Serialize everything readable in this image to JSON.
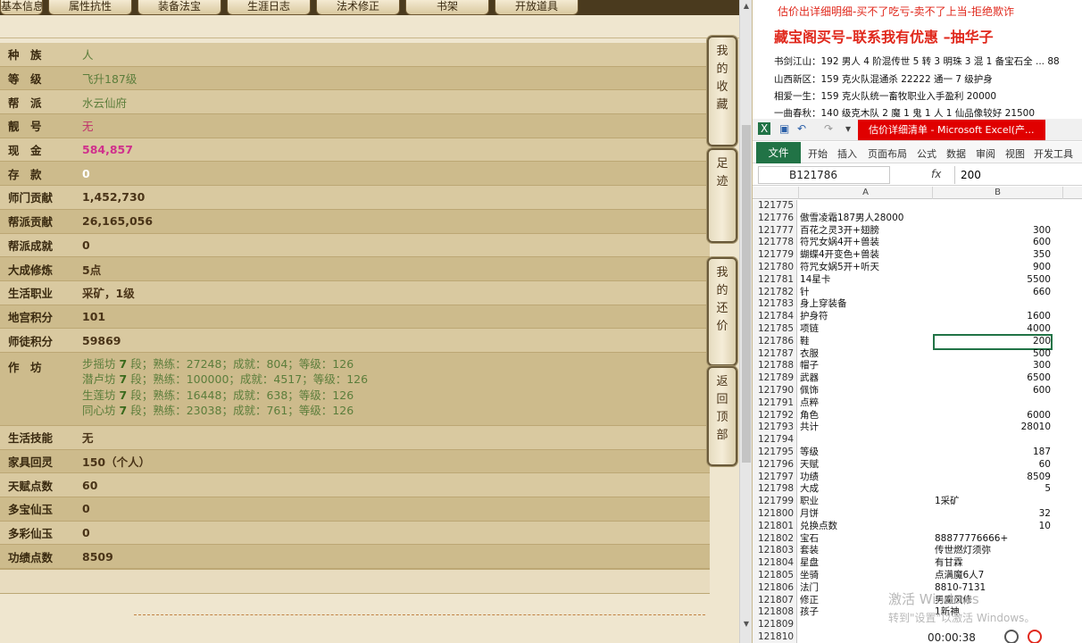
{
  "game": {
    "tabs": [
      "基本信息",
      "属性抗性",
      "装备法宝",
      "生涯日志",
      "法术修正",
      "书架",
      "开放道具"
    ],
    "rows": [
      {
        "label": "种　族",
        "value": "人",
        "style": "green"
      },
      {
        "label": "等　级",
        "value": "飞升187级",
        "style": "green"
      },
      {
        "label": "帮　派",
        "value": "水云仙府",
        "style": "green"
      },
      {
        "label": "靓　号",
        "value": "无",
        "style": "pink-plain"
      },
      {
        "label": "现　金",
        "value": "584,857",
        "style": "pink"
      },
      {
        "label": "存　款",
        "value": "0",
        "style": "white"
      },
      {
        "label": "师门贡献",
        "value": "1,452,730",
        "style": "dark"
      },
      {
        "label": "帮派贡献",
        "value": "26,165,056",
        "style": "dark"
      },
      {
        "label": "帮派成就",
        "value": "0",
        "style": "dark"
      },
      {
        "label": "大成修炼",
        "value": "5点",
        "style": "dark"
      },
      {
        "label": "生活职业",
        "value": "采矿，1级",
        "style": "dark"
      },
      {
        "label": "地宫积分",
        "value": "101",
        "style": "dark"
      },
      {
        "label": "师徒积分",
        "value": "59869",
        "style": "dark"
      }
    ],
    "workshop_label": "作　坊",
    "workshop": [
      {
        "name": "步摇坊",
        "level": "7",
        "rest": "段；熟练：27248；成就：804；等级：126"
      },
      {
        "name": "潜卢坊",
        "level": "7",
        "rest": "段；熟练：100000；成就：4517；等级：126"
      },
      {
        "name": "生莲坊",
        "level": "7",
        "rest": "段；熟练：16448；成就：638；等级：126"
      },
      {
        "name": "同心坊",
        "level": "7",
        "rest": "段；熟练：23038；成就：761；等级：126"
      }
    ],
    "rows2": [
      {
        "label": "生活技能",
        "value": "无",
        "style": "dark"
      },
      {
        "label": "家具回灵",
        "value": "150（个人）",
        "style": "dark"
      },
      {
        "label": "天赋点数",
        "value": "60",
        "style": "dark"
      },
      {
        "label": "多宝仙玉",
        "value": "0",
        "style": "dark"
      },
      {
        "label": "多彩仙玉",
        "value": "0",
        "style": "dark"
      },
      {
        "label": "功绩点数",
        "value": "8509",
        "style": "dark"
      }
    ],
    "side_buttons": [
      {
        "label": [
          "我",
          "的",
          "收",
          "藏"
        ]
      },
      {
        "label": [
          "足",
          "迹"
        ]
      },
      {
        "label": [
          "我",
          "的",
          "还",
          "价"
        ]
      },
      {
        "label": [
          "返",
          "回",
          "顶",
          "部"
        ]
      }
    ]
  },
  "notepad": {
    "line1": "估价出详细明细-买不了吃亏-卖不了上当-拒绝欺诈",
    "line2": "藏宝阁买号–联系我有优惠 –抽华子",
    "items": [
      "书剑江山：192 男人 4 阶混传世 5 转 3 明珠 3 混 1 备宝石全 ... 88",
      "山西新区：159 克火队混通杀 22222 通一 7 级护身",
      "相爱一生：159 克火队统一畜牧职业入手盈利 20000",
      "一曲春秋：140 级克木队 2 魔 1 鬼 1 人 1 仙品像较好 21500"
    ]
  },
  "excel": {
    "doc_title": "估价详细清单 - Microsoft Excel(产...",
    "file_tab": "文件",
    "menus": [
      "开始",
      "插入",
      "页面布局",
      "公式",
      "数据",
      "审阅",
      "视图",
      "开发工具"
    ],
    "name_box": "B121786",
    "fx": "fx",
    "formula_value": "200",
    "col_a": "A",
    "col_b": "B",
    "rows": [
      {
        "n": "121775",
        "a": "",
        "b": ""
      },
      {
        "n": "121776",
        "a": "傲雪凌霜187男人28000",
        "b": ""
      },
      {
        "n": "121777",
        "a": "百花之灵3开+翅膀",
        "b": "300"
      },
      {
        "n": "121778",
        "a": "符咒女娲4开+兽装",
        "b": "600"
      },
      {
        "n": "121779",
        "a": "蝴蝶4开变色+兽装",
        "b": "350"
      },
      {
        "n": "121780",
        "a": "符咒女娲5开+听天",
        "b": "900"
      },
      {
        "n": "121781",
        "a": "14星卡",
        "b": "5500"
      },
      {
        "n": "121782",
        "a": "针",
        "b": "660"
      },
      {
        "n": "121783",
        "a": "身上穿装备",
        "b": ""
      },
      {
        "n": "121784",
        "a": "护身符",
        "b": "1600"
      },
      {
        "n": "121785",
        "a": "项链",
        "b": "4000"
      },
      {
        "n": "121786",
        "a": "鞋",
        "b": "200"
      },
      {
        "n": "121787",
        "a": "衣服",
        "b": "500"
      },
      {
        "n": "121788",
        "a": "帽子",
        "b": "300"
      },
      {
        "n": "121789",
        "a": "武器",
        "b": "6500"
      },
      {
        "n": "121790",
        "a": "佩饰",
        "b": "600"
      },
      {
        "n": "121791",
        "a": "点粹",
        "b": ""
      },
      {
        "n": "121792",
        "a": "角色",
        "b": "6000"
      },
      {
        "n": "121793",
        "a": "共计",
        "b": "28010"
      },
      {
        "n": "121794",
        "a": "",
        "b": ""
      },
      {
        "n": "121795",
        "a": "等级",
        "b": "187"
      },
      {
        "n": "121796",
        "a": "天赋",
        "b": "60"
      },
      {
        "n": "121797",
        "a": "功绩",
        "b": "8509"
      },
      {
        "n": "121798",
        "a": "大成",
        "b": "5"
      },
      {
        "n": "121799",
        "a": "职业",
        "b": "1采矿",
        "bl": true
      },
      {
        "n": "121800",
        "a": "月饼",
        "b": "32"
      },
      {
        "n": "121801",
        "a": "兑换点数",
        "b": "10"
      },
      {
        "n": "121802",
        "a": "宝石",
        "b": "88877776666+",
        "bl": true
      },
      {
        "n": "121803",
        "a": "套装",
        "b": "传世燃灯须弥",
        "bl": true
      },
      {
        "n": "121804",
        "a": "星盘",
        "b": "有甘霖",
        "bl": true
      },
      {
        "n": "121805",
        "a": "坐骑",
        "b": "点满魔6人7",
        "bl": true
      },
      {
        "n": "121806",
        "a": "法门",
        "b": "8810-7131",
        "bl": true
      },
      {
        "n": "121807",
        "a": "修正",
        "b": "男魔风修",
        "bl": true
      },
      {
        "n": "121808",
        "a": "孩子",
        "b": "1新神",
        "bl": true
      },
      {
        "n": "121809",
        "a": "",
        "b": ""
      },
      {
        "n": "121810",
        "a": "",
        "b": ""
      }
    ],
    "watermark1": "激活 Windows",
    "watermark2": "转到\"设置\"以激活 Windows。",
    "timer": "00:00:38"
  }
}
